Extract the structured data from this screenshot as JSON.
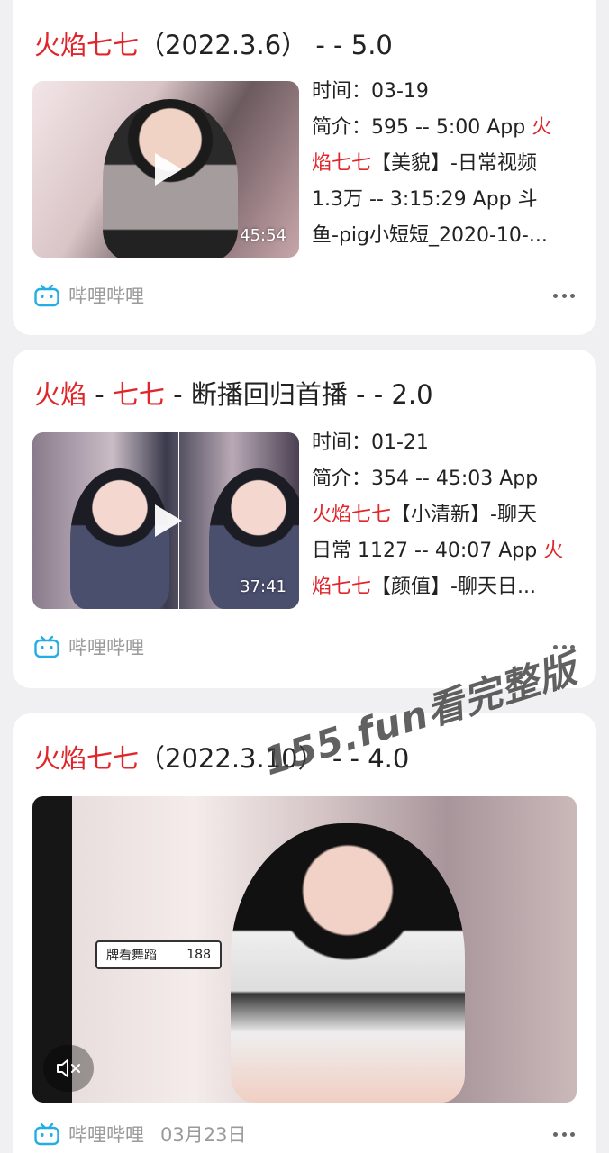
{
  "cards": [
    {
      "title_a": "火焰七七",
      "title_b": "（2022.3.6） - - 5.0",
      "duration": "45:54",
      "time_label": "时间：03-19",
      "intro_lines": [
        {
          "plain": "简介：595 -- 5:00 App ",
          "hl": "火"
        },
        {
          "hl": "焰七七",
          "plain": "【美貌】-日常视频"
        },
        {
          "plain": "1.3万 -- 3:15:29 App 斗"
        },
        {
          "plain": "鱼-pig小短短_2020-10-..."
        }
      ],
      "source": "哔哩哔哩"
    },
    {
      "title_hl1": "火焰",
      "title_mid": " - ",
      "title_hl2": "七七",
      "title_rest": " - 断播回归首播 - - 2.0",
      "duration": "37:41",
      "time_label": "时间：01-21",
      "intro_lines": [
        {
          "plain": "简介：354 -- 45:03 App"
        },
        {
          "hl": "火焰七七",
          "plain": "【小清新】-聊天"
        },
        {
          "plain": "日常 1127 -- 40:07 App ",
          "hl": "火"
        },
        {
          "hl": "焰七七",
          "plain": "【颜值】-聊天日..."
        }
      ],
      "source": "哔哩哔哩"
    },
    {
      "title_a": "火焰七七",
      "title_b": "（2022.3.10） - - 4.0",
      "badge_label": "牌看舞蹈",
      "badge_count": "188",
      "source": "哔哩哔哩",
      "date": "03月23日"
    }
  ],
  "watermark": "155.fun看完整版",
  "colors": {
    "highlight": "#e0262b",
    "bili_blue": "#23ade5",
    "background": "#f0f0f2"
  },
  "icons": [
    "play-icon",
    "bilibili-icon",
    "more-icon",
    "mute-icon"
  ]
}
